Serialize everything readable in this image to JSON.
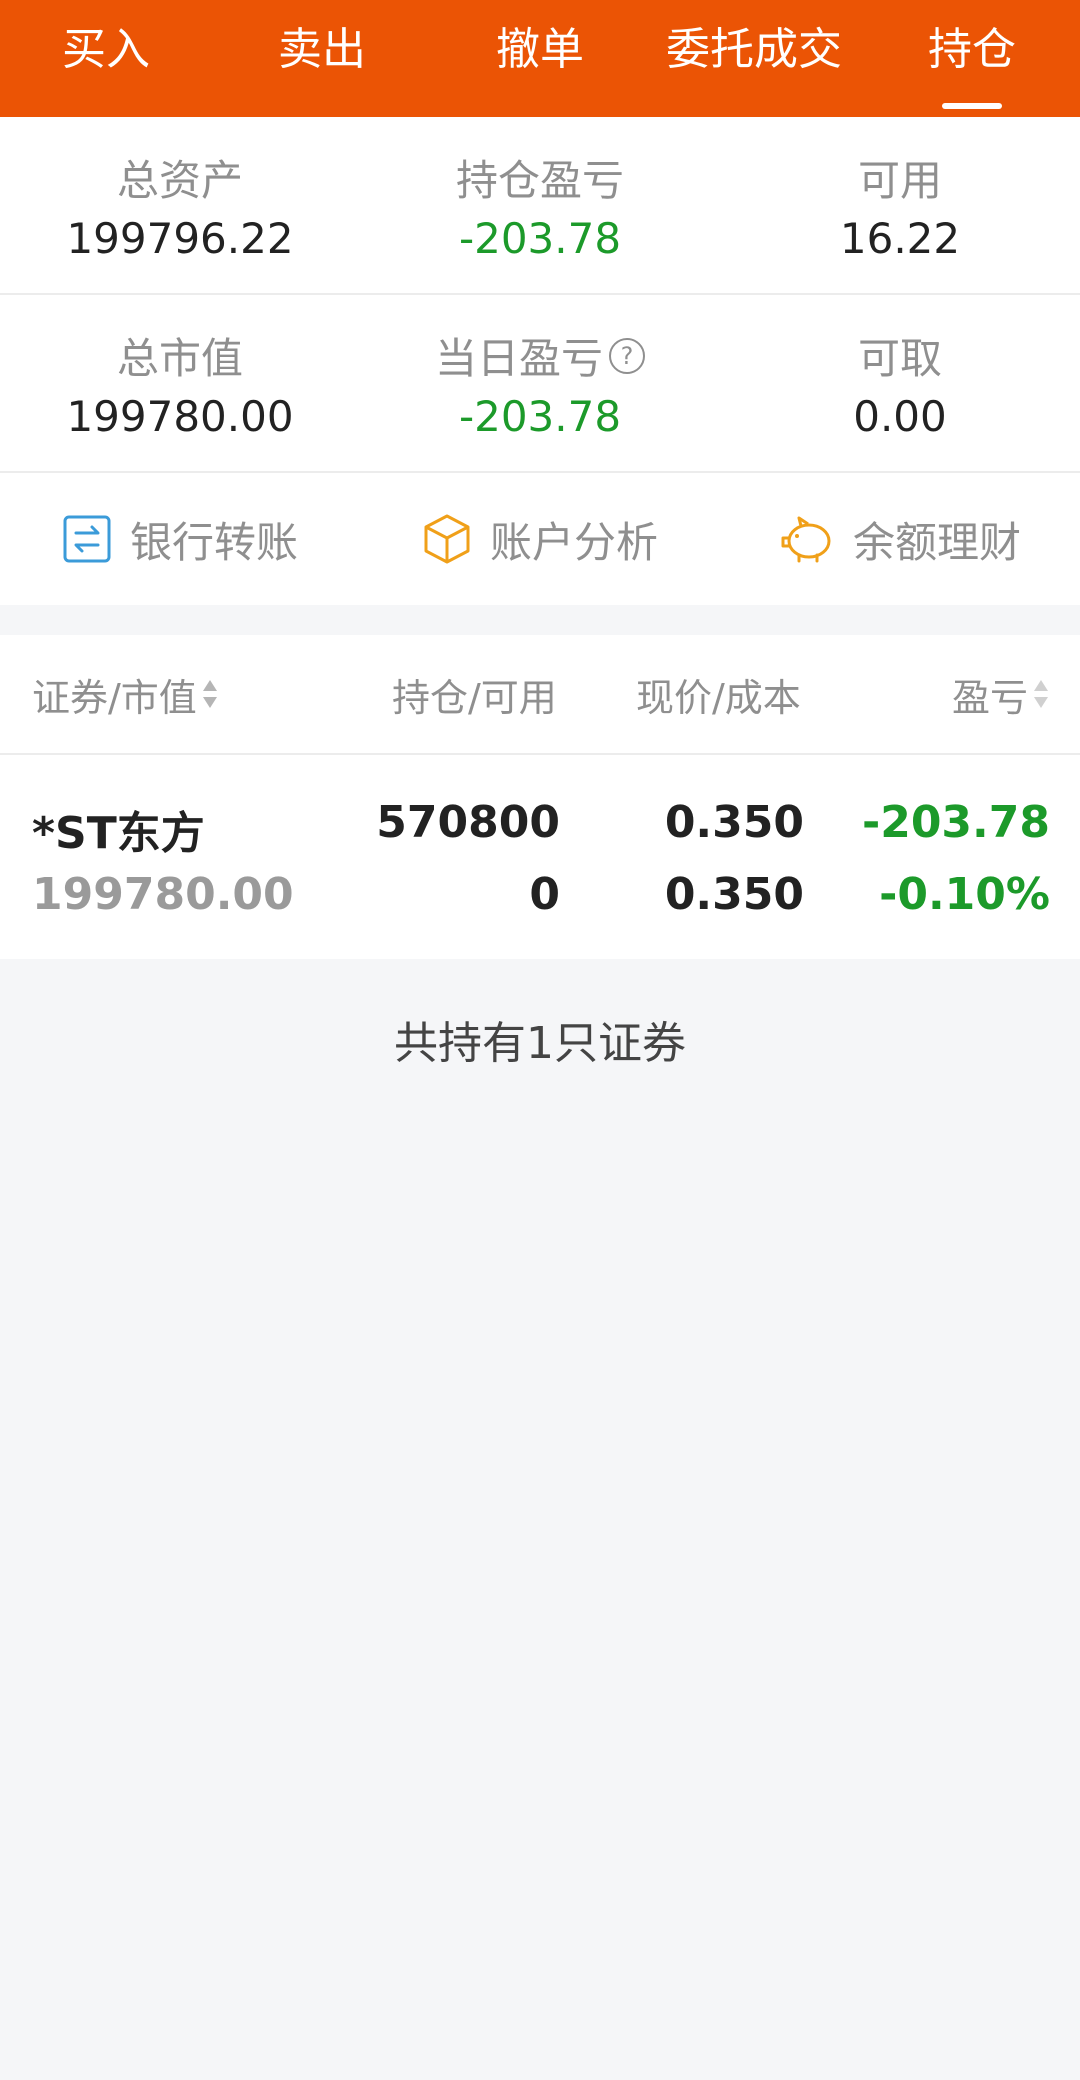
{
  "tabs": [
    {
      "label": "买入",
      "active": false
    },
    {
      "label": "卖出",
      "active": false
    },
    {
      "label": "撤单",
      "active": false
    },
    {
      "label": "委托成交",
      "active": false
    },
    {
      "label": "持仓",
      "active": true
    }
  ],
  "summary": {
    "total_assets": {
      "label": "总资产",
      "value": "199796.22"
    },
    "position_pnl": {
      "label": "持仓盈亏",
      "value": "-203.78"
    },
    "available": {
      "label": "可用",
      "value": "16.22"
    },
    "market_value": {
      "label": "总市值",
      "value": "199780.00"
    },
    "daily_pnl": {
      "label": "当日盈亏",
      "value": "-203.78",
      "help": "?"
    },
    "withdrawable": {
      "label": "可取",
      "value": "0.00"
    }
  },
  "actions": {
    "bank_transfer": "银行转账",
    "account_analysis": "账户分析",
    "wealth": "余额理财"
  },
  "table": {
    "headers": {
      "security": "证券/市值",
      "position": "持仓/可用",
      "price": "现价/成本",
      "pnl": "盈亏"
    },
    "rows": [
      {
        "name": "*ST东方",
        "market_value": "199780.00",
        "position": "570800",
        "available": "0",
        "price": "0.350",
        "cost": "0.350",
        "pnl": "-203.78",
        "pnl_pct": "-0.10%"
      }
    ]
  },
  "footer": "共持有1只证券",
  "colors": {
    "brand": "#eb5405",
    "loss": "#1c9a2a",
    "bank_icon": "#3b9bd9",
    "analysis_icon": "#f0a019",
    "wealth_icon": "#f0a019"
  },
  "icons": {
    "bank_transfer": "transfer-icon",
    "account_analysis": "cube-icon",
    "wealth": "piggy-bank-icon"
  }
}
